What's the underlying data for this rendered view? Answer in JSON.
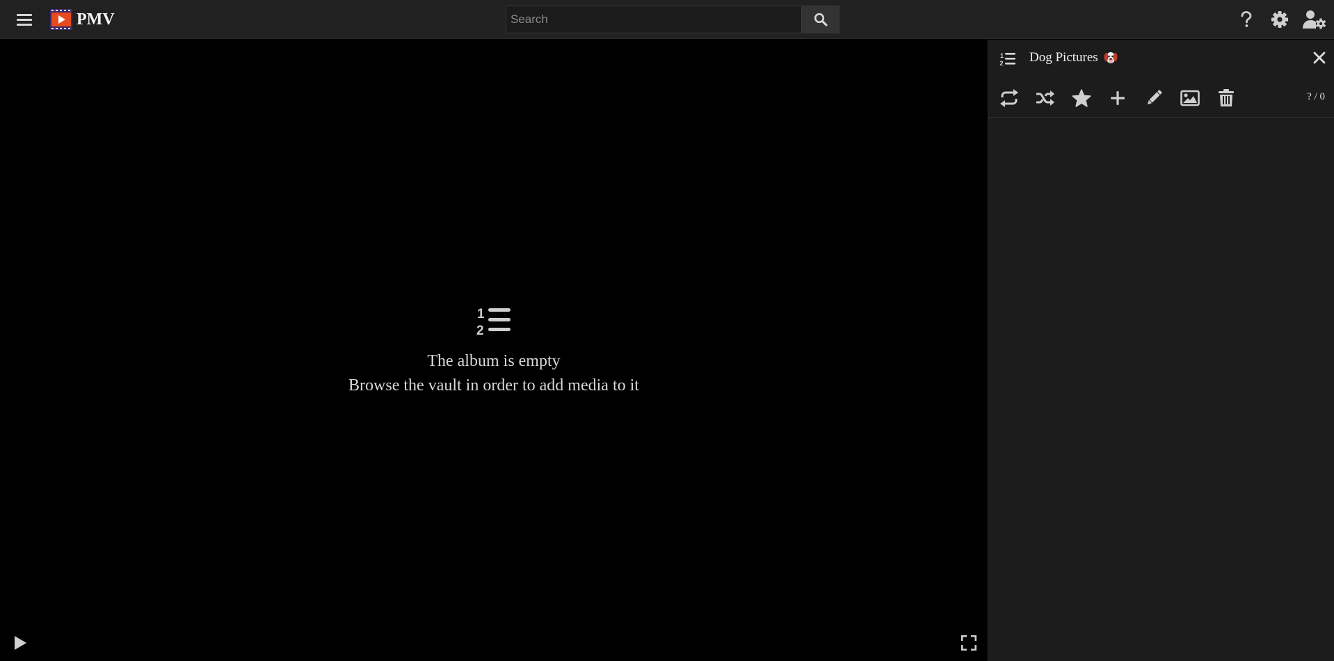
{
  "app": {
    "name": "PMV"
  },
  "search": {
    "placeholder": "Search"
  },
  "topbar": {
    "icons": [
      "menu-icon",
      "logo-icon",
      "search-icon",
      "help-icon",
      "gear-icon",
      "user-cog-icon"
    ]
  },
  "player": {
    "empty_title": "The album is empty",
    "empty_subtitle": "Browse the vault in order to add media to it",
    "icons": [
      "ordered-list-icon",
      "play-icon",
      "fullscreen-icon"
    ]
  },
  "album": {
    "title": "Dog Pictures",
    "emoji": "dog-face-emoji",
    "position": "? / 0",
    "tools": [
      "repeat-icon",
      "shuffle-icon",
      "star-icon",
      "plus-icon",
      "pencil-icon",
      "image-icon",
      "trash-icon"
    ]
  },
  "colors": {
    "topbar_bg": "#212121",
    "sidebar_bg": "#1c1c1c",
    "player_bg": "#000000",
    "icon": "#cfcfcf",
    "logo_accent": "#e8491d"
  }
}
